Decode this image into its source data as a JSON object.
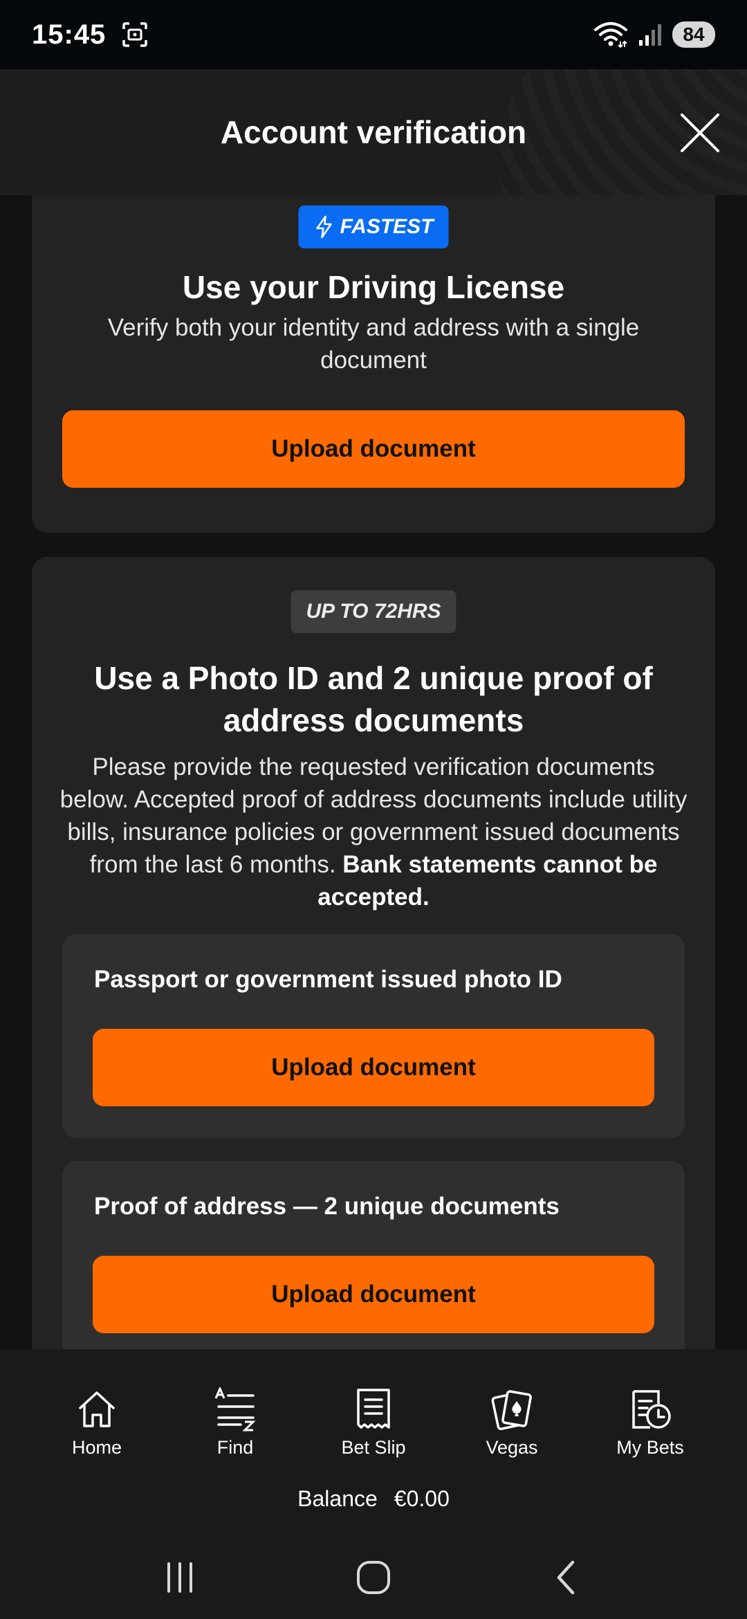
{
  "status_bar": {
    "time": "15:45",
    "battery": "84"
  },
  "header": {
    "title": "Account verification"
  },
  "card1": {
    "badge": "FASTEST",
    "title": "Use your Driving License",
    "description": "Verify both your identity and address with a single document",
    "button_label": "Upload document"
  },
  "card2": {
    "badge": "UP TO 72HRS",
    "title_line1": "Use a Photo ID and 2 unique proof of",
    "title_line2": "address documents",
    "description": "Please provide the requested verification documents below. Accepted proof of address documents include utility bills, insurance policies or government issued documents from the last 6 months. ",
    "description_bold": "Bank statements cannot be accepted.",
    "photo_id": {
      "title": "Passport or government issued photo ID",
      "button_label": "Upload document"
    },
    "proof_address": {
      "title": "Proof of address — 2 unique documents",
      "button_label": "Upload document"
    }
  },
  "bottom_nav": {
    "items": [
      {
        "label": "Home",
        "icon": "home-icon"
      },
      {
        "label": "Find",
        "icon": "sort-az-icon"
      },
      {
        "label": "Bet Slip",
        "icon": "receipt-icon"
      },
      {
        "label": "Vegas",
        "icon": "cards-icon"
      },
      {
        "label": "My Bets",
        "icon": "bets-history-icon"
      }
    ],
    "balance_label": "Balance",
    "balance_value": "€0.00"
  },
  "colors": {
    "accent": "#ff6a00",
    "badge_blue": "#0a6cf2",
    "card_bg": "#232323",
    "subcard_bg": "#2f2f2f"
  }
}
